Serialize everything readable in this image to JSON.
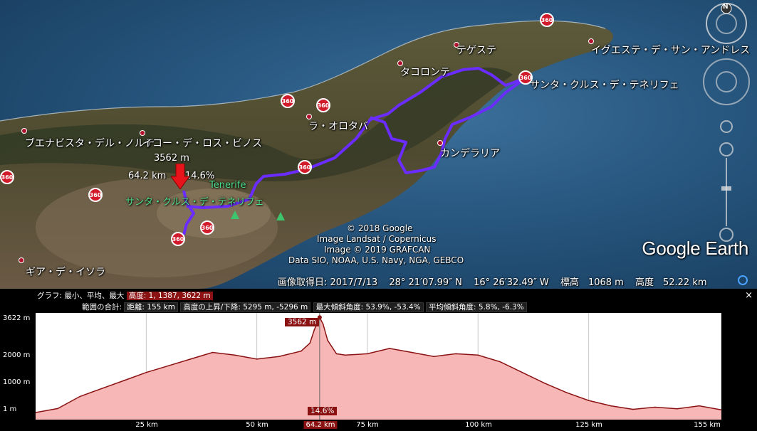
{
  "map": {
    "places": [
      {
        "name": "テゲステ"
      },
      {
        "name": "イグエステ・デ・サン・アンドレス"
      },
      {
        "name": "タコロンテ"
      },
      {
        "name": "サンタ・クルス・デ・テネリフェ"
      },
      {
        "name": "ラ・オロタバ"
      },
      {
        "name": "ブエナビスタ・デル・ノルテ"
      },
      {
        "name": "イコー・デ・ロス・ビノス"
      },
      {
        "name": "カンデラリア"
      },
      {
        "name": "ギア・デ・イソラ"
      }
    ],
    "green_labels": {
      "island": "Tenerife",
      "santa_cruz_green": "サンタ・クルス・デ・テネリフェ"
    },
    "pano_badge": "360",
    "hover_marker": {
      "elevation": "3562 m",
      "distance": "64.2 km",
      "slope": "14.6%"
    },
    "credits": {
      "line1": "© 2018 Google",
      "line2": "Image Landsat / Copernicus",
      "line3": "Image © 2019 GRAFCAN",
      "line4": "Data SIO, NOAA, U.S. Navy, NGA, GEBCO"
    },
    "logo": "Google Earth",
    "status": {
      "imagery_date": "画像取得日: 2017/7/13",
      "lat": "28° 21′07.99″ N",
      "lon": "16° 26′32.49″ W",
      "elevation": "標高　1068 m",
      "altitude": "高度　52.22 km"
    },
    "compass": "N"
  },
  "profile": {
    "graph_label": "グラフ: 最小、平均、最大",
    "graph_values": "高度: 1, 1387, 3622 m",
    "range_label": "範囲の合計:",
    "distance": "距離: 155 km",
    "gain_loss": "高度の上昇/下降: 5295 m, -5296 m",
    "max_slope": "最大傾斜角度: 53.9%, -53.4%",
    "avg_slope": "平均傾斜角度: 5.8%, -6.3%",
    "close": "×",
    "y_ticks": [
      "3622 m",
      "2000 m",
      "1000 m",
      "1 m"
    ],
    "x_ticks": [
      "25 km",
      "50 km",
      "64.2 km",
      "75 km",
      "100 km",
      "125 km",
      "155 km"
    ],
    "cursor_elevation": "3562 m",
    "cursor_slope": "14.6%",
    "colors": {
      "fill": "#f7b7b7",
      "line": "#8a1212",
      "highlight": "#8a1212"
    }
  },
  "chart_data": {
    "type": "area",
    "x": [
      0,
      5,
      10,
      15,
      20,
      25,
      30,
      35,
      40,
      45,
      50,
      55,
      60,
      62,
      63,
      64.2,
      65,
      66,
      68,
      70,
      75,
      80,
      85,
      90,
      95,
      100,
      105,
      110,
      115,
      120,
      125,
      130,
      135,
      140,
      145,
      150,
      155
    ],
    "y": [
      1,
      150,
      600,
      900,
      1200,
      1500,
      1750,
      2000,
      2250,
      2150,
      2000,
      2100,
      2300,
      2600,
      3100,
      3562,
      3300,
      2700,
      2200,
      2150,
      2200,
      2400,
      2250,
      2100,
      2200,
      2150,
      1900,
      1500,
      1100,
      750,
      450,
      250,
      120,
      200,
      140,
      250,
      100
    ],
    "xlim": [
      0,
      155
    ],
    "ylim": [
      1,
      3622
    ],
    "xlabel": "",
    "ylabel": ""
  }
}
